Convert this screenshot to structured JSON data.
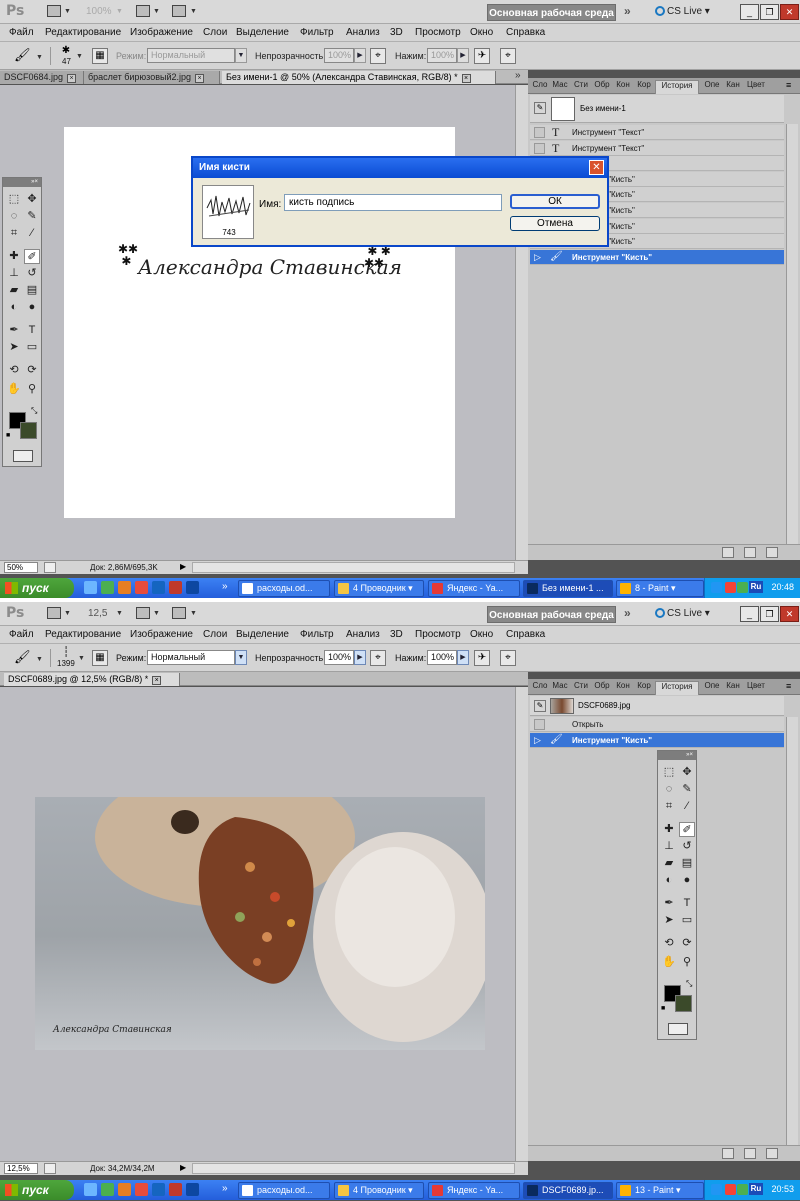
{
  "top": {
    "logo": "Ps",
    "zoom": "100%",
    "workspace": "Основная рабочая среда",
    "cslive": "CS Live",
    "menu": [
      "Файл",
      "Редактирование",
      "Изображение",
      "Слои",
      "Выделение",
      "Фильтр",
      "Анализ",
      "3D",
      "Просмотр",
      "Окно",
      "Справка"
    ],
    "options": {
      "brush_size": "47",
      "mode_label": "Режим:",
      "mode_value": "Нормальный",
      "opacity_label": "Непрозрачность:",
      "opacity_value": "100%",
      "flow_label": "Нажим:",
      "flow_value": "100%"
    },
    "tabs": [
      "DSCF0684.jpg",
      "браслет бирюзовый2.jpg",
      "Без имени-1 @ 50% (Александра Ставинская, RGB/8) *"
    ],
    "status": {
      "zoom": "50%",
      "doc": "Док: 2,86M/695,3K"
    },
    "panel_tabs": [
      "Сло",
      "Мас",
      "Сти",
      "Обр",
      "Кон",
      "Кор",
      "История",
      "Опе",
      "Кан",
      "Цвет"
    ],
    "snapshot": "Без имени-1",
    "history": [
      {
        "icon": "text",
        "label": "Инструмент \"Текст\""
      },
      {
        "icon": "text",
        "label": "Инструмент \"Текст\""
      },
      {
        "icon": "none",
        "label": "ать слой"
      },
      {
        "icon": "brush",
        "label": "струмент \"Кисть\""
      },
      {
        "icon": "brush",
        "label": "струмент \"Кисть\""
      },
      {
        "icon": "brush",
        "label": "струмент \"Кисть\""
      },
      {
        "icon": "brush",
        "label": "струмент \"Кисть\""
      },
      {
        "icon": "brush",
        "label": "струмент \"Кисть\""
      },
      {
        "icon": "brush",
        "label": "Инструмент \"Кисть\"",
        "selected": true
      }
    ],
    "dialog": {
      "title": "Имя кисти",
      "brush_number": "743",
      "name_label": "Имя:",
      "name_value": "кисть подпись",
      "ok": "ОК",
      "cancel": "Отмена"
    },
    "signature": "Александра Ставинская",
    "taskbar": {
      "start": "пуск",
      "tasks": [
        "расходы.od...",
        "4 Проводник",
        "Яндекс - Ya...",
        "Без имени-1 ...",
        "8 - Paint"
      ],
      "lang": "Ru",
      "time": "20:48"
    }
  },
  "bottom": {
    "logo": "Ps",
    "zoom": "12,5",
    "workspace": "Основная рабочая среда",
    "cslive": "CS Live",
    "menu": [
      "Файл",
      "Редактирование",
      "Изображение",
      "Слои",
      "Выделение",
      "Фильтр",
      "Анализ",
      "3D",
      "Просмотр",
      "Окно",
      "Справка"
    ],
    "options": {
      "brush_size": "1399",
      "mode_label": "Режим:",
      "mode_value": "Нормальный",
      "opacity_label": "Непрозрачность:",
      "opacity_value": "100%",
      "flow_label": "Нажим:",
      "flow_value": "100%"
    },
    "tab": "DSCF0689.jpg @ 12,5% (RGB/8) *",
    "status": {
      "zoom": "12,5%",
      "doc": "Док: 34,2M/34,2M"
    },
    "panel_tabs": [
      "Сло",
      "Мас",
      "Сти",
      "Обр",
      "Кон",
      "Кор",
      "История",
      "Опе",
      "Кан",
      "Цвет"
    ],
    "snapshot": "DSCF0689.jpg",
    "history": [
      {
        "icon": "none",
        "label": "Открыть"
      },
      {
        "icon": "brush",
        "label": "Инструмент \"Кисть\"",
        "selected": true
      }
    ],
    "signature": "Александра Ставинская",
    "taskbar": {
      "start": "пуск",
      "tasks": [
        "расходы.od...",
        "4 Проводник",
        "Яндекс - Ya...",
        "DSCF0689.jp...",
        "13 - Paint"
      ],
      "lang": "Ru",
      "time": "20:53"
    }
  }
}
